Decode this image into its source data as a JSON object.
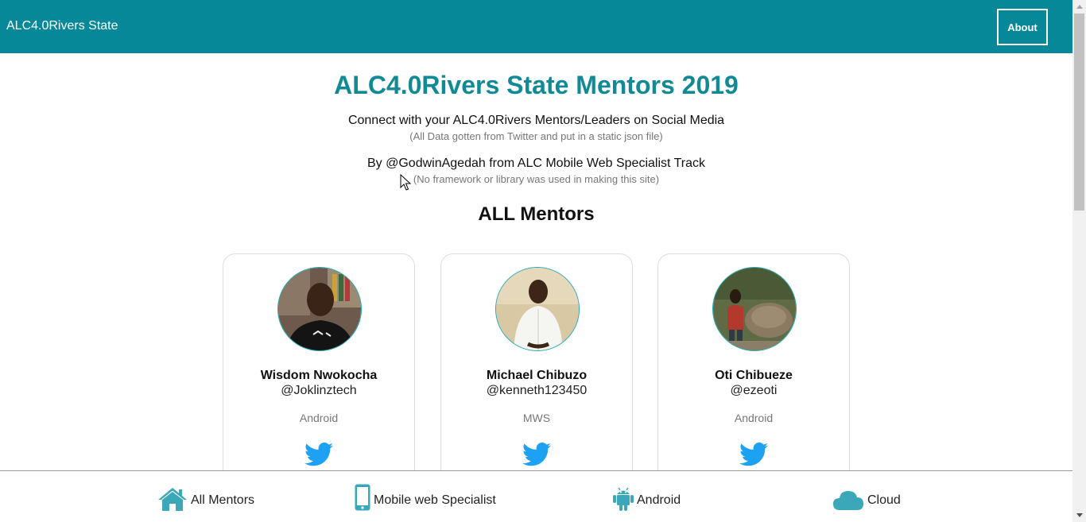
{
  "navbar": {
    "brand": "ALC4.0Rivers State",
    "about_label": "About"
  },
  "header": {
    "title": "ALC4.0Rivers State Mentors 2019",
    "subtitle": "Connect with your ALC4.0Rivers Mentors/Leaders on Social Media",
    "subtitle_note": "(All Data gotten from Twitter and put in a static json file)",
    "byline": "By @GodwinAgedah from ALC Mobile Web Specialist Track",
    "byline_note": "(No framework or library was used in making this site)"
  },
  "section_title": "ALL Mentors",
  "mentors": [
    {
      "name": "Wisdom Nwokocha",
      "handle": "@Joklinztech",
      "track": "Android",
      "icon": "twitter-icon"
    },
    {
      "name": "Michael Chibuzo",
      "handle": "@kenneth123450",
      "track": "MWS",
      "icon": "twitter-icon"
    },
    {
      "name": "Oti Chibueze",
      "handle": "@ezeoti",
      "track": "Android",
      "icon": "twitter-icon"
    }
  ],
  "footer": {
    "items": [
      {
        "label": "All Mentors",
        "icon": "home-icon"
      },
      {
        "label": "Mobile web Specialist",
        "icon": "mobile-phone-icon"
      },
      {
        "label": "Android",
        "icon": "android-icon"
      },
      {
        "label": "Cloud",
        "icon": "cloud-icon"
      }
    ]
  },
  "colors": {
    "primary": "#078898",
    "title": "#118a95",
    "twitter": "#1da1f2",
    "footer_icon": "#3aa8b8"
  }
}
